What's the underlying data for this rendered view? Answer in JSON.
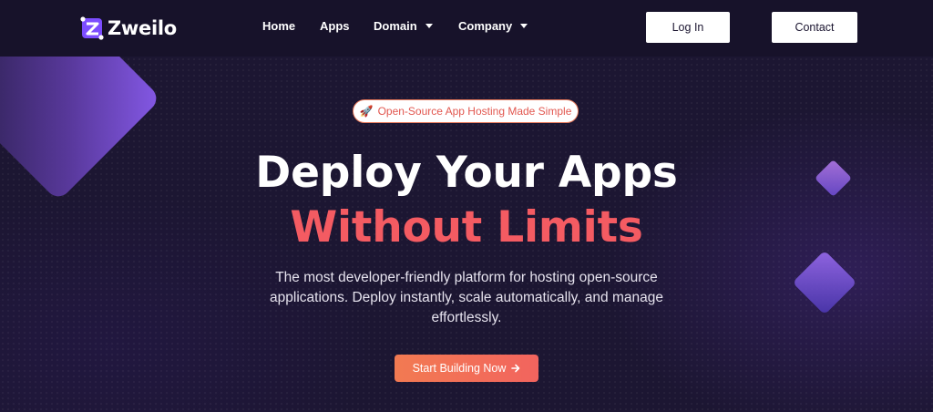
{
  "brand": {
    "name": "Zweilo"
  },
  "nav": {
    "items": [
      {
        "label": "Home"
      },
      {
        "label": "Apps"
      },
      {
        "label": "Domain"
      },
      {
        "label": "Company"
      }
    ],
    "login_label": "Log In",
    "contact_label": "Contact"
  },
  "hero": {
    "badge": "Open-Source App Hosting Made Simple",
    "badge_icon": "rocket-icon",
    "title_line1": "Deploy Your Apps",
    "title_line2": "Without Limits",
    "subtitle": "The most developer-friendly platform for hosting open-source applications. Deploy instantly, scale automatically, and manage effortlessly.",
    "cta_label": "Start Building Now",
    "cta_icon": "arrow-right-icon"
  },
  "colors": {
    "background": "#1c1632",
    "accent": "#f45b62",
    "cta_gradient_start": "#f27a52",
    "cta_gradient_end": "#f2645e",
    "brand_purple": "#7c4dff"
  }
}
